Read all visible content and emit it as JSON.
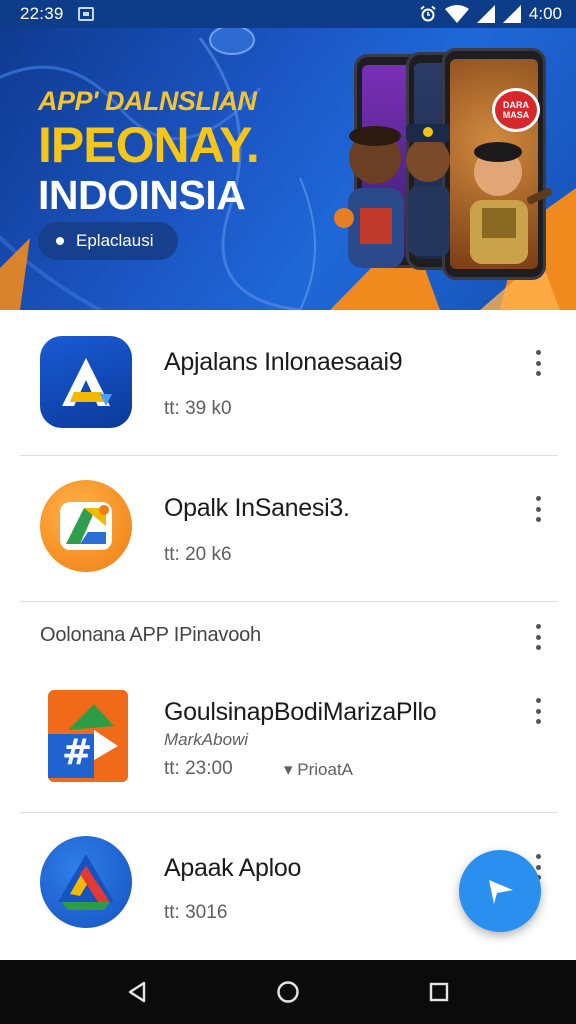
{
  "status_bar": {
    "time": "22:39",
    "clock_right": "4:00",
    "icons": [
      "notification-icon",
      "alarm-icon",
      "wifi-icon",
      "signal-icon"
    ]
  },
  "banner": {
    "kicker": "APP' DALNSLIAN",
    "headline": "IPEONAY.",
    "subline": "INDOINSIA",
    "pill_label": "Eplaclausi",
    "badge_text": "DARA MASA",
    "colors": {
      "background": "#1c56c4",
      "accent": "#f5c518",
      "orange": "#f08a1f"
    }
  },
  "apps": [
    {
      "name": "Apjalans Inlonaesaai9",
      "meta": "tt: 39 k0",
      "icon": "blue-a-app-icon"
    },
    {
      "name": "Opalk InSanesi3.",
      "meta": "tt: 20 k6",
      "icon": "orange-g-app-icon"
    }
  ],
  "section": {
    "title": "Oolonana APP IPinavooh"
  },
  "section_apps": [
    {
      "name": "GoulsinapBodiMarizaPllo",
      "sub": "MarkAbowi",
      "meta": "tt: 23:00",
      "tag": "PrioatA",
      "icon": "arrow-app-icon"
    },
    {
      "name": "Apaak Aploo",
      "meta": "tt: 3016",
      "icon": "drive-like-app-icon"
    }
  ],
  "fab": {
    "icon": "send-icon"
  },
  "nav": {
    "back": "back-icon",
    "home": "home-icon",
    "recents": "recents-icon"
  }
}
